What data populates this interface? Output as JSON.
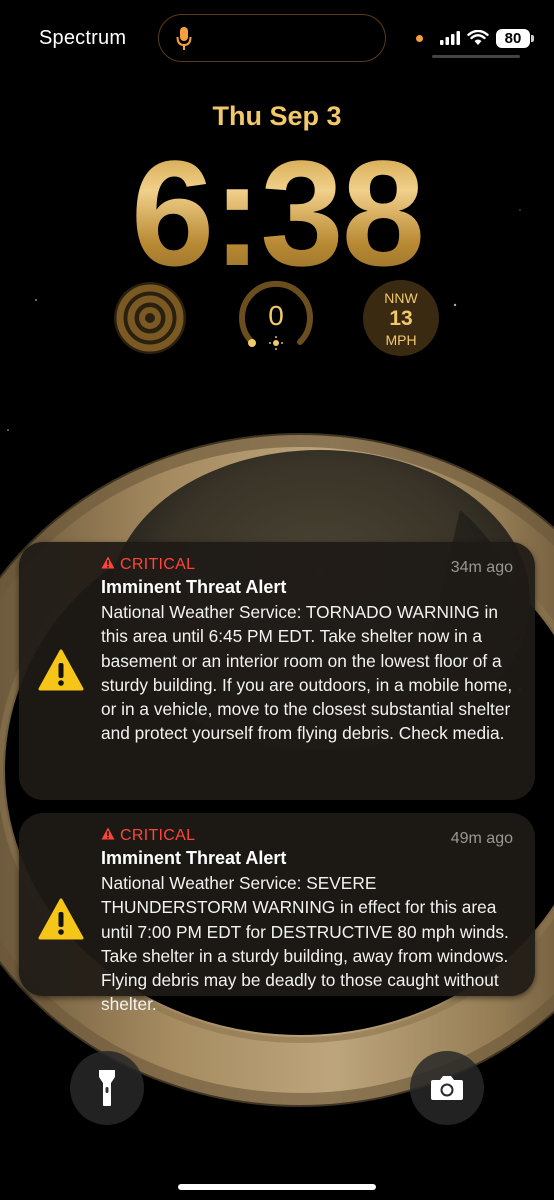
{
  "status_bar": {
    "carrier": "Spectrum",
    "battery": "80",
    "icons": [
      "microphone-icon",
      "privacy-dot",
      "cellular-signal-icon",
      "wifi-icon",
      "battery-icon"
    ]
  },
  "lock_screen": {
    "date": "Thu Sep 3",
    "time": "6:38"
  },
  "widgets": {
    "rings": {
      "icon": "concentric-rings-icon"
    },
    "uv_index": {
      "value": "0",
      "level": 0.0,
      "icon": "sun-icon"
    },
    "wind": {
      "direction": "NNW",
      "speed": "13",
      "unit": "MPH"
    }
  },
  "notifications": [
    {
      "badge": "CRITICAL",
      "time_ago": "34m ago",
      "title": "Imminent Threat Alert",
      "body": "National Weather Service: TORNADO WARNING in this area until 6:45 PM EDT. Take shelter now in a basement or an interior room on the lowest floor of a sturdy building. If you are outdoors, in a mobile home, or in a vehicle, move to the closest substantial shelter and protect yourself from flying debris. Check media."
    },
    {
      "badge": "CRITICAL",
      "time_ago": "49m ago",
      "title": "Imminent Threat Alert",
      "body": "National Weather Service: SEVERE THUNDERSTORM WARNING in effect for this area until 7:00 PM EDT for DESTRUCTIVE 80 mph winds. Take shelter in a sturdy building, away from windows. Flying debris may be deadly to those caught without shelter."
    }
  ],
  "quick_actions": {
    "left": {
      "icon": "flashlight-icon"
    },
    "right": {
      "icon": "camera-icon"
    }
  },
  "colors": {
    "accent_gold": "#f2c96a",
    "critical_red": "#ff453a",
    "warning_yellow": "#f5c518"
  }
}
